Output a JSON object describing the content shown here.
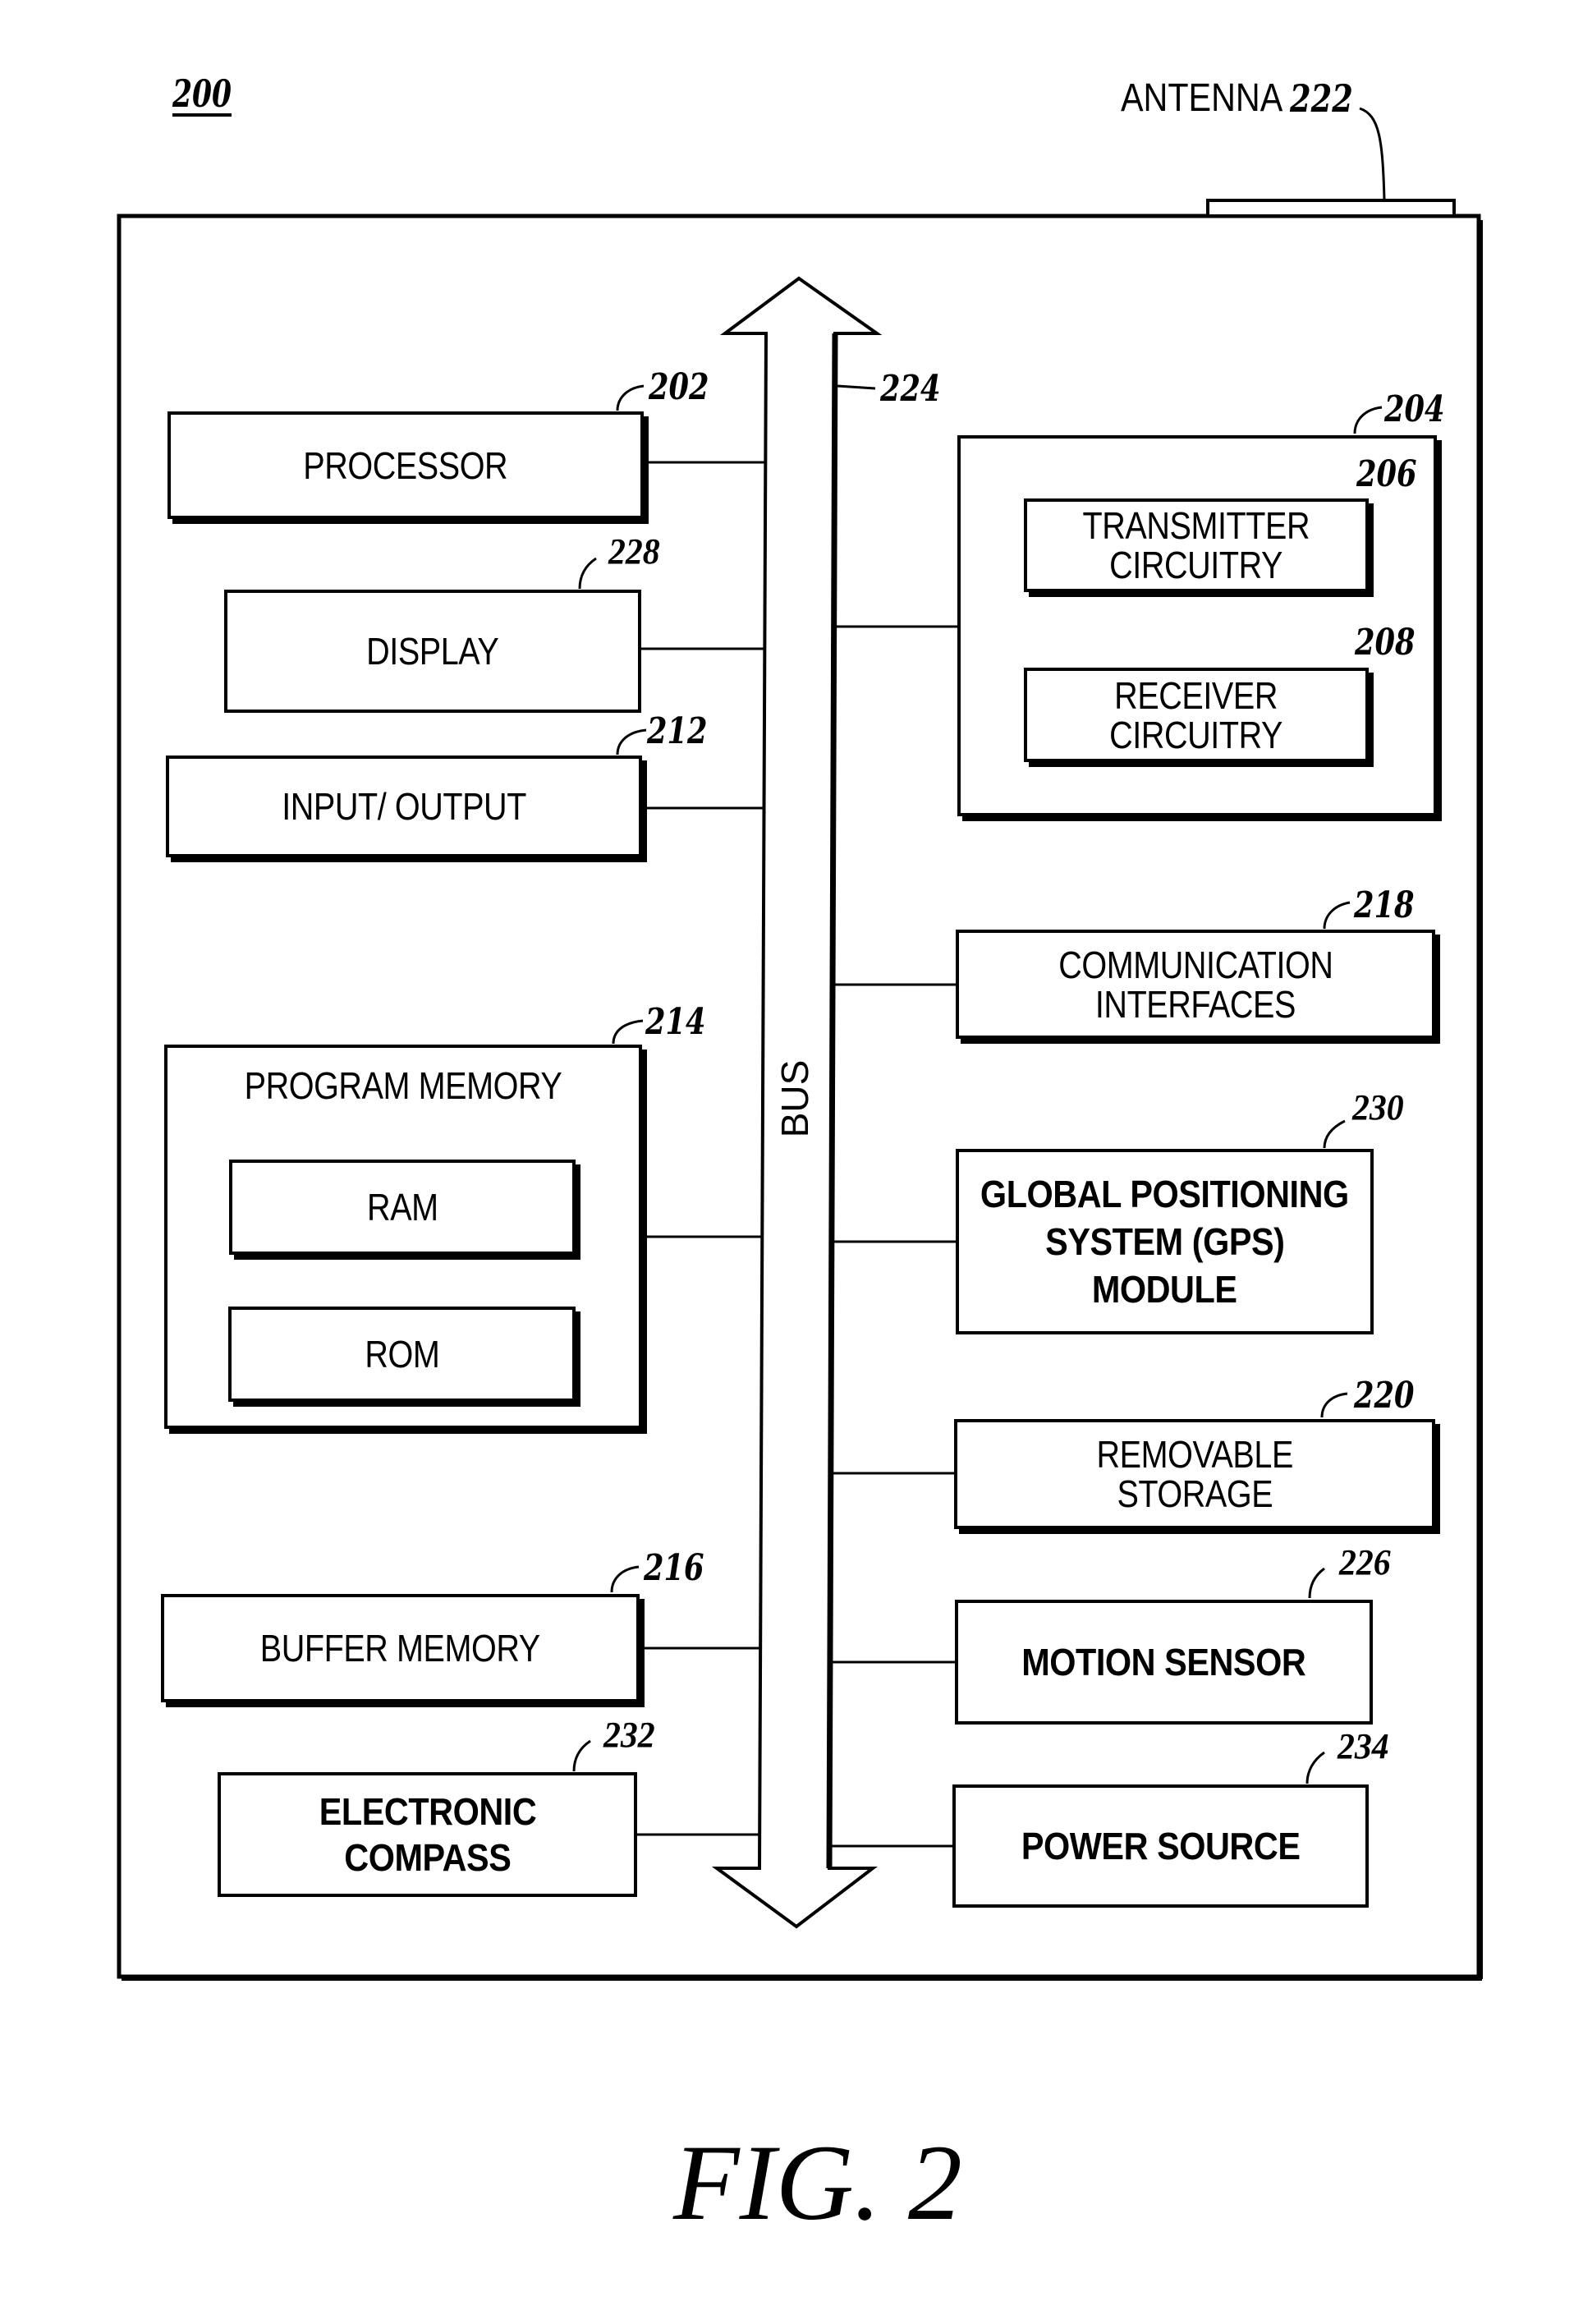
{
  "figure": {
    "ref": "200",
    "caption": "FIG. 2"
  },
  "antenna": {
    "label": "ANTENNA",
    "ref": "222"
  },
  "bus": {
    "label": "BUS",
    "ref": "224"
  },
  "left_blocks": {
    "processor": {
      "lines": [
        "PROCESSOR"
      ],
      "ref": "202"
    },
    "display": {
      "lines": [
        "DISPLAY"
      ],
      "ref": "228"
    },
    "io": {
      "lines": [
        "INPUT/ OUTPUT"
      ],
      "ref": "212"
    },
    "program_memory": {
      "title": "PROGRAM MEMORY",
      "ref": "214",
      "ram": "RAM",
      "rom": "ROM"
    },
    "buffer_memory": {
      "lines": [
        "BUFFER MEMORY"
      ],
      "ref": "216"
    },
    "electronic_compass": {
      "lines": [
        "ELECTRONIC",
        "COMPASS"
      ],
      "ref": "232"
    }
  },
  "right_blocks": {
    "transceiver": {
      "ref": "204",
      "transmitter": {
        "lines": [
          "TRANSMITTER",
          "CIRCUITRY"
        ],
        "ref": "206"
      },
      "receiver": {
        "lines": [
          "RECEIVER",
          "CIRCUITRY"
        ],
        "ref": "208"
      }
    },
    "communication_interfaces": {
      "lines": [
        "COMMUNICATION",
        "INTERFACES"
      ],
      "ref": "218"
    },
    "gps_module": {
      "lines": [
        "GLOBAL POSITIONING",
        "SYSTEM (GPS)",
        "MODULE"
      ],
      "ref": "230"
    },
    "removable_storage": {
      "lines": [
        "REMOVABLE",
        "STORAGE"
      ],
      "ref": "220"
    },
    "motion_sensor": {
      "lines": [
        "MOTION SENSOR"
      ],
      "ref": "226"
    },
    "power_source": {
      "lines": [
        "POWER SOURCE"
      ],
      "ref": "234"
    }
  }
}
